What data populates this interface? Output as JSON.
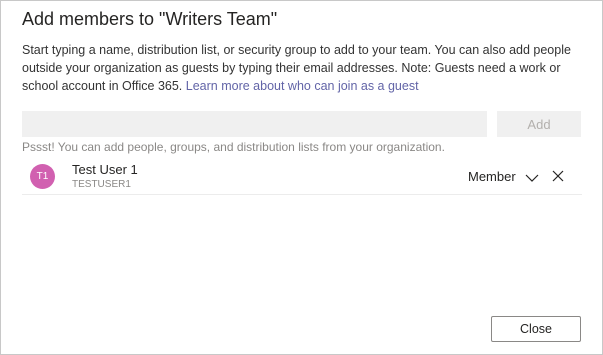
{
  "dialog": {
    "title": "Add members to \"Writers Team\"",
    "description": "Start typing a name, distribution list, or security group to add to your team. You can also add people outside your organization as guests by typing their email addresses. Note: Guests need a work or school account in Office 365. ",
    "learn_more_link": "Learn more about who can join as a guest",
    "search": {
      "value": "",
      "placeholder": ""
    },
    "add_button": "Add",
    "hint": "Pssst! You can add people, groups, and distribution lists from your organization.",
    "members": [
      {
        "initials": "T1",
        "name": "Test User 1",
        "subtitle": "TESTUSER1",
        "role": "Member",
        "avatar_color": "#d160b0"
      }
    ],
    "close_button": "Close"
  },
  "colors": {
    "link": "#6264a7",
    "input_bg": "#f0f0f0",
    "disabled_text": "#b3b0ad",
    "hint_text": "#8a8886"
  }
}
